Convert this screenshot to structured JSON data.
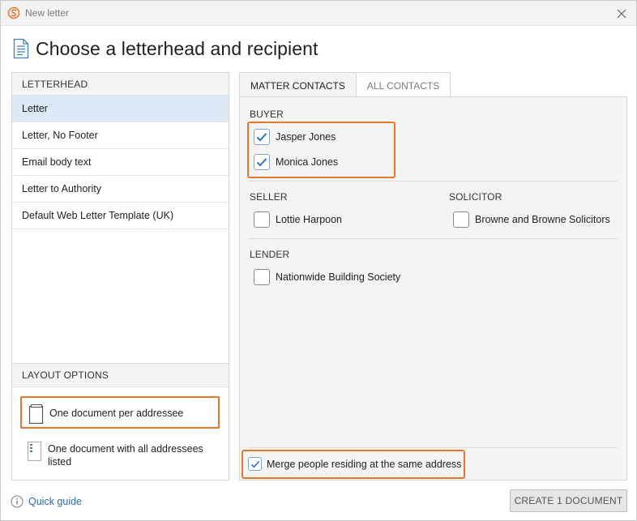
{
  "window": {
    "title": "New letter",
    "heading": "Choose a letterhead and recipient",
    "accent_color": "#e8762f",
    "selection_color": "#dce9f6",
    "check_color": "#2f74c6"
  },
  "letterhead": {
    "header": "LETTERHEAD",
    "items": [
      {
        "label": "Letter",
        "selected": true
      },
      {
        "label": "Letter, No Footer",
        "selected": false
      },
      {
        "label": "Email body text",
        "selected": false
      },
      {
        "label": "Letter to Authority",
        "selected": false
      },
      {
        "label": "Default Web Letter Template (UK)",
        "selected": false
      }
    ]
  },
  "layout_options": {
    "header": "LAYOUT OPTIONS",
    "options": [
      {
        "label": "One document per addressee",
        "icon": "single-document-icon",
        "selected": true
      },
      {
        "label": "One document with all addressees listed",
        "icon": "list-document-icon",
        "selected": false
      }
    ]
  },
  "tabs": [
    {
      "label": "MATTER CONTACTS",
      "active": true
    },
    {
      "label": "ALL CONTACTS",
      "active": false
    }
  ],
  "contacts": {
    "buyer": {
      "label": "BUYER",
      "people": [
        {
          "name": "Jasper Jones",
          "checked": true
        },
        {
          "name": "Monica Jones",
          "checked": true
        }
      ]
    },
    "seller": {
      "label": "SELLER",
      "people": [
        {
          "name": "Lottie Harpoon",
          "checked": false
        }
      ]
    },
    "solicitor": {
      "label": "SOLICITOR",
      "people": [
        {
          "name": "Browne and Browne Solicitors",
          "checked": false
        }
      ]
    },
    "lender": {
      "label": "LENDER",
      "people": [
        {
          "name": "Nationwide Building Society",
          "checked": false
        }
      ]
    }
  },
  "merge": {
    "label": "Merge people residing at the same address",
    "checked": true
  },
  "footer": {
    "quick_guide": "Quick guide",
    "create_button": "CREATE 1 DOCUMENT"
  }
}
